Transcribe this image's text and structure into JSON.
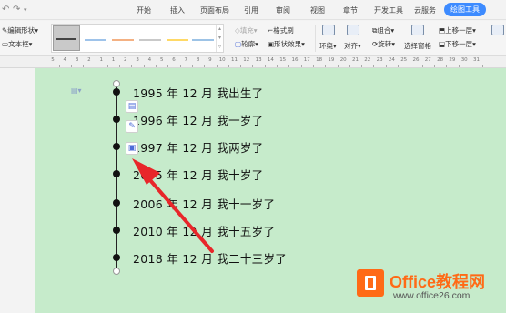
{
  "titlebar": {
    "tabs": [
      "开始",
      "插入",
      "页面布局",
      "引用",
      "审阅",
      "视图",
      "章节",
      "开发工具",
      "云服务",
      "绘图工具"
    ],
    "active_tab": "绘图工具"
  },
  "ribbon": {
    "edit_shape": "编辑形状",
    "textbox": "文本框",
    "fill": "填充",
    "outline": "轮廓",
    "format_painter": "格式刷",
    "shape_effects": "形状效果",
    "wrap": "环绕",
    "align": "对齐",
    "group": "组合",
    "rotate": "旋转",
    "selection_pane": "选择窗格",
    "bring_forward": "上移一层",
    "send_backward": "下移一层",
    "style_colors": [
      "#9ec3ea",
      "#f4b183",
      "#c9c9c9",
      "#ffd966",
      "#9dc3e6"
    ]
  },
  "ruler": {
    "numbers": [
      "5",
      "4",
      "3",
      "2",
      "1",
      "1",
      "2",
      "3",
      "4",
      "5",
      "6",
      "7",
      "8",
      "9",
      "10",
      "11",
      "12",
      "13",
      "14",
      "15",
      "16",
      "17",
      "18",
      "19",
      "20",
      "21",
      "22",
      "23",
      "24",
      "25",
      "26",
      "27",
      "28",
      "29",
      "30",
      "31"
    ]
  },
  "document": {
    "background": "#c6ebcb",
    "entries": [
      {
        "year": "1995",
        "year_label": "年",
        "month": "12",
        "month_label": "月",
        "event": "我出生了"
      },
      {
        "year": "1996",
        "year_label": "年",
        "month": "12",
        "month_label": "月",
        "event": "我一岁了"
      },
      {
        "year": "1997",
        "year_label": "年",
        "month": "12",
        "month_label": "月",
        "event": "我两岁了"
      },
      {
        "year": "2005",
        "year_label": "年",
        "month": "12",
        "month_label": "月",
        "event": "我十岁了"
      },
      {
        "year": "2006",
        "year_label": "年",
        "month": "12",
        "month_label": "月",
        "event": "我十一岁了"
      },
      {
        "year": "2010",
        "year_label": "年",
        "month": "12",
        "month_label": "月",
        "event": "我十五岁了"
      },
      {
        "year": "2018",
        "year_label": "年",
        "month": "12",
        "month_label": "月",
        "event": "我二十三岁了"
      }
    ],
    "float_toolbar_icons": [
      "layout-options-icon",
      "pen-icon",
      "shape-fill-icon"
    ],
    "arrow_color": "#e8262a"
  },
  "watermark": {
    "title": "Office教程网",
    "url": "www.office26.com",
    "color": "#ff6a16"
  }
}
